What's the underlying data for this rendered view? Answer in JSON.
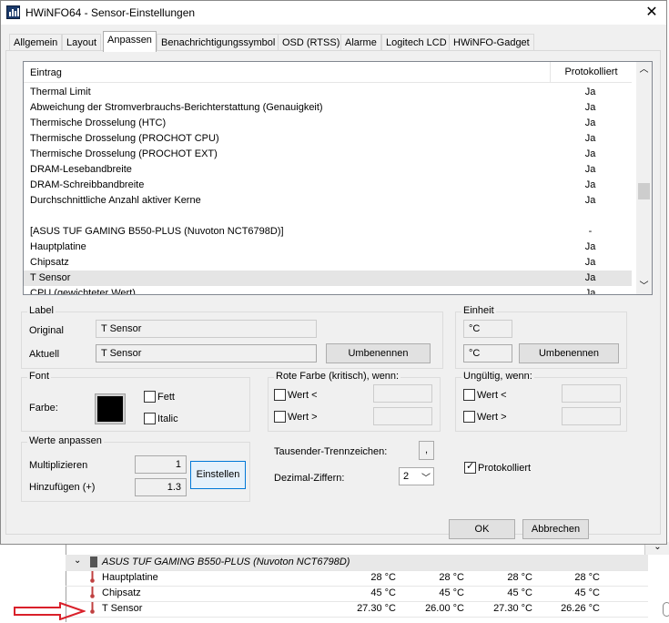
{
  "window": {
    "title": "HWiNFO64 - Sensor-Einstellungen",
    "close_glyph": "✕"
  },
  "tabs": [
    {
      "label": "Allgemein"
    },
    {
      "label": "Layout"
    },
    {
      "label": "Anpassen"
    },
    {
      "label": "Benachrichtigungssymbol"
    },
    {
      "label": "OSD (RTSS)"
    },
    {
      "label": "Alarme"
    },
    {
      "label": "Logitech LCD"
    },
    {
      "label": "HWiNFO-Gadget"
    }
  ],
  "list": {
    "col_entry": "Eintrag",
    "col_logged": "Protokolliert",
    "rows": [
      {
        "name": "Thermal Limit",
        "logged": "Ja"
      },
      {
        "name": "Abweichung der Stromverbrauchs-Berichterstattung (Genauigkeit)",
        "logged": "Ja"
      },
      {
        "name": "Thermische Drosselung (HTC)",
        "logged": "Ja"
      },
      {
        "name": "Thermische Drosselung (PROCHOT CPU)",
        "logged": "Ja"
      },
      {
        "name": "Thermische Drosselung (PROCHOT EXT)",
        "logged": "Ja"
      },
      {
        "name": "DRAM-Lesebandbreite",
        "logged": "Ja"
      },
      {
        "name": "DRAM-Schreibbandbreite",
        "logged": "Ja"
      },
      {
        "name": "Durchschnittliche Anzahl aktiver Kerne",
        "logged": "Ja"
      },
      {
        "name": "",
        "logged": ""
      },
      {
        "name": "[ASUS TUF GAMING B550-PLUS (Nuvoton NCT6798D)]",
        "logged": "-"
      },
      {
        "name": "Hauptplatine",
        "logged": "Ja"
      },
      {
        "name": "Chipsatz",
        "logged": "Ja"
      },
      {
        "name": "T Sensor",
        "logged": "Ja",
        "selected": true
      },
      {
        "name": "CPU (gewichteter Wert)",
        "logged": "Ja"
      }
    ]
  },
  "label_group": {
    "title": "Label",
    "original_label": "Original",
    "original_value": "T Sensor",
    "current_label": "Aktuell",
    "current_value": "T Sensor",
    "rename_button": "Umbenennen"
  },
  "unit_group": {
    "title": "Einheit",
    "original_value": "°C",
    "current_value": "°C",
    "rename_button": "Umbenennen"
  },
  "font_group": {
    "title": "Font",
    "color_label": "Farbe:",
    "color": "#000000",
    "bold_label": "Fett",
    "bold_checked": false,
    "italic_label": "Italic",
    "italic_checked": false
  },
  "red_group": {
    "title": "Rote Farbe (kritisch), wenn:",
    "lt_label": "Wert <",
    "lt_checked": false,
    "gt_label": "Wert >",
    "gt_checked": false
  },
  "invalid_group": {
    "title": "Ungültig, wenn:",
    "lt_label": "Wert <",
    "lt_checked": false,
    "gt_label": "Wert >",
    "gt_checked": false
  },
  "adjust_group": {
    "title": "Werte anpassen",
    "multiply_label": "Multiplizieren",
    "multiply_value": "1",
    "add_label": "Hinzufügen (+)",
    "add_value": "1.3",
    "apply_button": "Einstellen"
  },
  "thousands_label": "Tausender-Trennzeichen:",
  "thousands_value": ",",
  "decimals_label": "Dezimal-Ziffern:",
  "decimals_value": "2",
  "logged_label": "Protokolliert",
  "logged_checked": true,
  "ok_button": "OK",
  "cancel_button": "Abbrechen",
  "background": {
    "group_row": "ASUS TUF GAMING B550-PLUS (Nuvoton NCT6798D)",
    "rows": [
      {
        "name": "Hauptplatine",
        "v1": "28 °C",
        "v2": "28 °C",
        "v3": "28 °C",
        "v4": "28 °C"
      },
      {
        "name": "Chipsatz",
        "v1": "45 °C",
        "v2": "45 °C",
        "v3": "45 °C",
        "v4": "45 °C"
      },
      {
        "name": "T Sensor",
        "v1": "27.30 °C",
        "v2": "26.00 °C",
        "v3": "27.30 °C",
        "v4": "26.26 °C"
      }
    ],
    "arrow_color": "#d9202a"
  }
}
